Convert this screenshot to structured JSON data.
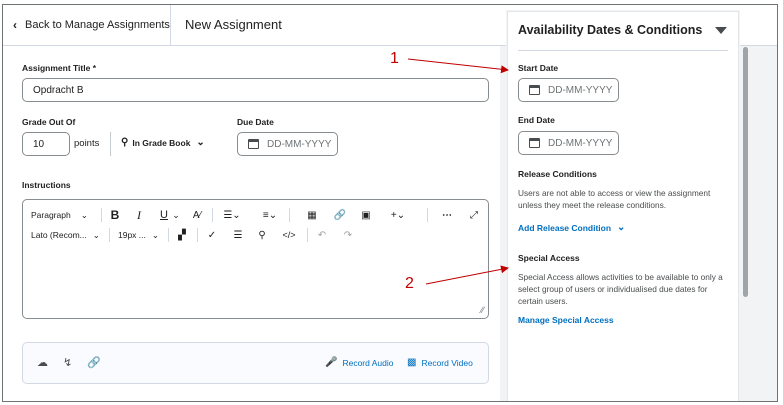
{
  "header": {
    "back_label": "Back to Manage Assignments",
    "page_title": "New Assignment"
  },
  "form": {
    "title_label": "Assignment Title *",
    "title_value": "Opdracht B",
    "grade_label": "Grade Out Of",
    "grade_value": "10",
    "points_label": "points",
    "grade_book_label": "In Grade Book",
    "due_label": "Due Date",
    "due_placeholder": "DD-MM-YYYY",
    "instructions_label": "Instructions",
    "toolbar": {
      "paragraph": "Paragraph",
      "font": "Lato (Recom...",
      "size": "19px ...",
      "bold": "B",
      "italic": "I",
      "underline": "U"
    },
    "record_audio": "Record Audio",
    "record_video": "Record Video"
  },
  "panel": {
    "title": "Availability Dates & Conditions",
    "start_label": "Start Date",
    "start_placeholder": "DD-MM-YYYY",
    "end_label": "End Date",
    "end_placeholder": "DD-MM-YYYY",
    "release_label": "Release Conditions",
    "release_text": "Users are not able to access or view the assignment unless they meet the release conditions.",
    "add_release": "Add Release Condition",
    "special_label": "Special Access",
    "special_text": "Special Access allows activities to be available to only a select group of users or individualised due dates for certain users.",
    "manage_special": "Manage Special Access"
  },
  "annotations": {
    "one": "1",
    "two": "2"
  },
  "colors": {
    "link": "#006fbf",
    "annotation": "#c00000"
  }
}
